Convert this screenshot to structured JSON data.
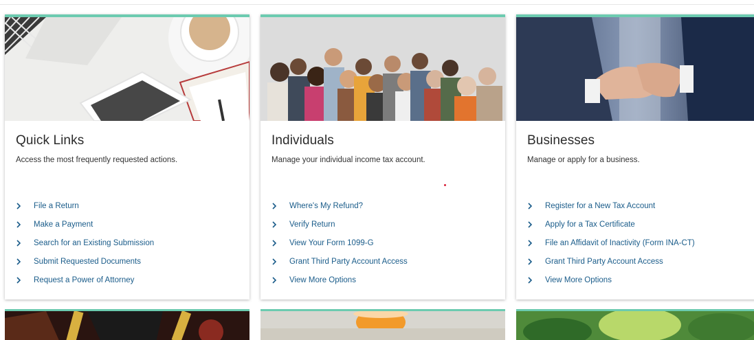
{
  "cards": [
    {
      "title": "Quick Links",
      "description": "Access the most frequently requested actions.",
      "image": "desk-laptop-coffee-tablet-photo",
      "links": [
        {
          "label": "File a Return"
        },
        {
          "label": "Make a Payment"
        },
        {
          "label": "Search for an Existing Submission"
        },
        {
          "label": "Submit Requested Documents"
        },
        {
          "label": "Request a Power of Attorney"
        }
      ]
    },
    {
      "title": "Individuals",
      "description": "Manage your individual income tax account.",
      "image": "diverse-group-of-people-photo",
      "links": [
        {
          "label": "Where's My Refund?"
        },
        {
          "label": "Verify Return"
        },
        {
          "label": "View Your Form 1099-G"
        },
        {
          "label": "Grant Third Party Account Access"
        },
        {
          "label": "View More Options"
        }
      ]
    },
    {
      "title": "Businesses",
      "description": "Manage or apply for a business.",
      "image": "business-handshake-photo",
      "links": [
        {
          "label": "Register for a New Tax Account"
        },
        {
          "label": "Apply for a Tax Certificate"
        },
        {
          "label": "File an Affidavit of Inactivity (Form INA-CT)"
        },
        {
          "label": "Grant Third Party Account Access"
        },
        {
          "label": "View More Options"
        }
      ]
    }
  ],
  "lower_cards": [
    {
      "image": "casino-chips-photo"
    },
    {
      "image": "orange-drink-photo"
    },
    {
      "image": "green-leaves-photo"
    }
  ],
  "colors": {
    "accent": "#6ccbb0",
    "link": "#1a5c8a",
    "chevron": "#1a5c8a"
  }
}
